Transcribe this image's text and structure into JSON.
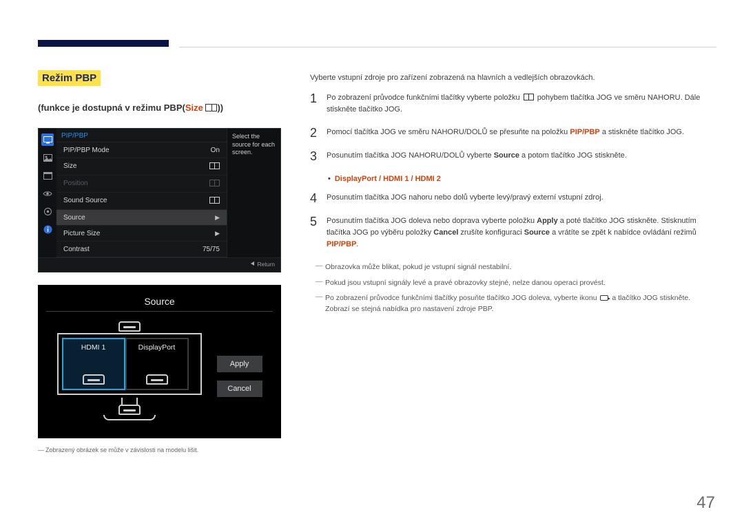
{
  "page_number": "47",
  "heading": "Režim PBP",
  "subheading_prefix": "(funkce je dostupná v režimu PBP(",
  "subheading_size": "Size",
  "subheading_suffix": "))",
  "osd": {
    "title": "PIP/PBP",
    "side_text": "Select the source for each screen.",
    "rows": {
      "mode_label": "PIP/PBP Mode",
      "mode_value": "On",
      "size_label": "Size",
      "position_label": "Position",
      "sound_label": "Sound Source",
      "source_label": "Source",
      "psize_label": "Picture Size",
      "contrast_label": "Contrast",
      "contrast_value": "75/75"
    },
    "return_label": "Return"
  },
  "srcpanel": {
    "title": "Source",
    "left_label": "HDMI 1",
    "right_label": "DisplayPort",
    "apply": "Apply",
    "cancel": "Cancel"
  },
  "left_footnote": "Zobrazený obrázek se může v závislosti na modelu lišit.",
  "right": {
    "intro": "Vyberte vstupní zdroje pro zařízení zobrazená na hlavních a vedlejších obrazovkách.",
    "step1a": "Po zobrazení průvodce funkčními tlačítky vyberte položku ",
    "step1b": " pohybem tlačítka JOG ve směru NAHORU. Dále stiskněte tlačítko JOG.",
    "step2a": "Pomocí tlačítka JOG ve směru NAHORU/DOLŮ se přesuňte na položku ",
    "step2_pip": "PIP/PBP",
    "step2b": " a stiskněte tlačítko JOG.",
    "step3a": "Posunutím tlačítka JOG NAHORU/DOLŮ vyberte ",
    "step3_source": "Source",
    "step3b": " a potom tlačítko JOG stiskněte.",
    "bullet_options": "DisplayPort / HDMI 1 / HDMI 2",
    "step4": "Posunutím tlačítka JOG nahoru nebo dolů vyberte levý/pravý externí vstupní zdroj.",
    "step5a": "Posunutím tlačítka JOG doleva nebo doprava vyberte položku ",
    "step5_apply": "Apply",
    "step5b": " a poté tlačítko JOG stiskněte. Stisknutím tlačítka JOG po výběru položky ",
    "step5_cancel": "Cancel",
    "step5c": " zrušíte konfiguraci ",
    "step5_source": "Source",
    "step5d": " a vrátíte se zpět k nabídce ovládání režimů ",
    "step5_pip": "PIP/PBP",
    "step5e": ".",
    "fn1": "Obrazovka může blikat, pokud je vstupní signál nestabilní.",
    "fn2": "Pokud jsou vstupní signály levé a pravé obrazovky stejné, nelze danou operaci provést.",
    "fn3a": "Po zobrazení průvodce funkčními tlačítky posuňte tlačítko JOG doleva, vyberte ikonu ",
    "fn3b": " a tlačítko JOG stiskněte. Zobrazí se stejná nabídka pro nastavení zdroje PBP."
  }
}
